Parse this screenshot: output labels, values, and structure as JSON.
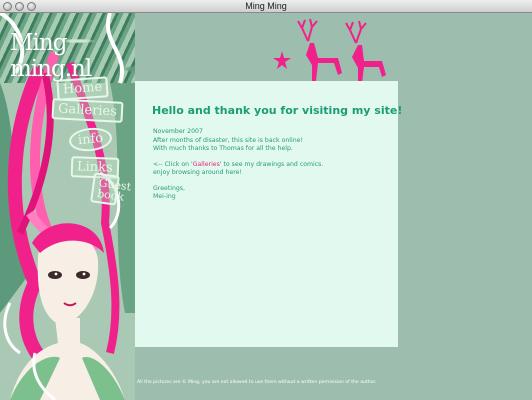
{
  "window": {
    "title": "Ming Ming"
  },
  "site": {
    "logo": "Ming ming.nl"
  },
  "nav": {
    "home": "Home",
    "galleries": "Galleries",
    "info": "info",
    "links": "Links",
    "guestbook": "Guest book"
  },
  "content": {
    "greeting": "Hello and thank you for visiting my site!",
    "date": "November 2007",
    "line1": "After months of disaster, this site is back online!",
    "line2": "With much thanks to Thomas for all the help.",
    "click_prefix": "<-- Click on '",
    "click_link": "Galleries",
    "click_suffix": "' to see my drawings and comics.",
    "enjoy": "enjoy browsing around here!",
    "sign1": "Greetings,",
    "sign2": "Mei-ing"
  },
  "footer": {
    "text": "All the pictures are © Ming, you are not allowed to use them without a written permission of the author."
  },
  "colors": {
    "accent_pink": "#f0218a",
    "panel": "#e1f9ee",
    "page_bg": "#9dbdaf",
    "text_green": "#1b9d75"
  }
}
